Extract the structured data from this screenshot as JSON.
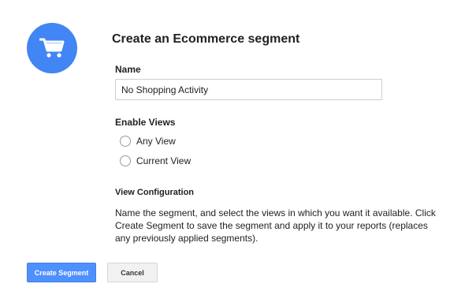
{
  "dialog": {
    "title": "Create an Ecommerce segment",
    "icon": "shopping-cart-icon",
    "accent_color": "#4285f4"
  },
  "name_field": {
    "label": "Name",
    "value": "No Shopping Activity"
  },
  "enable_views": {
    "label": "Enable Views",
    "options": [
      {
        "label": "Any View",
        "checked": false
      },
      {
        "label": "Current View",
        "checked": false
      }
    ]
  },
  "view_configuration": {
    "label": "View Configuration",
    "description": "Name the segment, and select the views in which you want it available. Click Create Segment to save the segment and apply it to your reports (replaces any previously applied segments)."
  },
  "buttons": {
    "create_label": "Create Segment",
    "cancel_label": "Cancel",
    "primary_color": "#4d90fe"
  }
}
